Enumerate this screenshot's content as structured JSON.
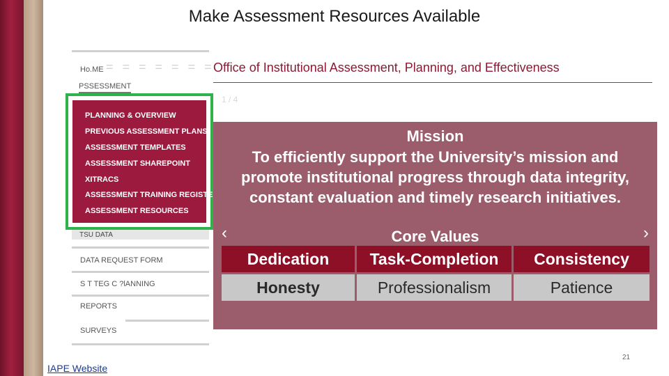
{
  "slide": {
    "title": "Make Assessment  Resources Available",
    "page_number": "21",
    "footer_link": "IAPE Website"
  },
  "nav": {
    "home": "Ho.ME",
    "dashes": "= = = = = = =",
    "assessment": "PSSESSMENT",
    "menu": [
      "PLANNING & OVERVIEW",
      "PREVIOUS ASSESSMENT PLANS",
      "ASSESSMENT TEMPLATES",
      "ASSESSMENT SHAREPOINT",
      "XITRACS",
      "ASSESSMENT TRAINING REGISTER",
      "ASSESSMENT RESOURCES"
    ],
    "tsu_data": "TSU DATA",
    "links": [
      "DATA REQUEST FORM",
      "S  T  TEG  C ?lANNING",
      "REPORTS",
      "SURVEYS"
    ]
  },
  "content": {
    "office_title": "Office of Institutional Assessment, Planning, and Effectiveness",
    "slide_counter": "1 / 4",
    "mission_heading": "Mission",
    "mission_text": "To efficiently support the University’s mission and promote institutional progress through data integrity, constant evaluation and timely research initiatives.",
    "core_values_heading": "Core Values",
    "prev_arrow": "‹",
    "next_arrow": "›",
    "values_row1": [
      "Dedication",
      "Task-Completion",
      "Consistency"
    ],
    "values_row2": [
      "Honesty",
      "Professionalism",
      "Patience"
    ],
    "colors": {
      "maroon": "#8e1027",
      "menu_bg": "#9b1a3e",
      "highlight_border": "#2db34a",
      "panel_bg": "#9b5d6c",
      "title_color": "#8b1a33"
    }
  }
}
